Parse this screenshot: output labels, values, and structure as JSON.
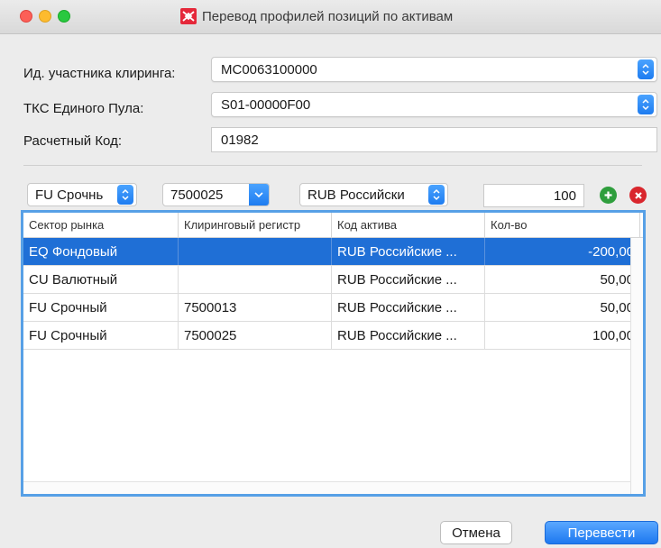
{
  "window": {
    "title": "Перевод профилей позиций по активам",
    "accent": "#1f6fd6"
  },
  "form": {
    "participant_label": "Ид. участника клиринга:",
    "participant_value": "MC0063100000",
    "tks_label": "ТКС Единого Пула:",
    "tks_value": "S01-00000F00",
    "code_label": "Расчетный Код:",
    "code_value": "01982"
  },
  "filters": {
    "sector_value": "FU Срочнь",
    "register_value": "7500025",
    "asset_value": "RUB Российски",
    "quantity_value": "100"
  },
  "table": {
    "columns": [
      "Сектор рынка",
      "Клиринговый регистр",
      "Код актива",
      "Кол-во"
    ],
    "rows": [
      {
        "sector": "EQ Фондовый",
        "register": "",
        "asset": "RUB Российские ...",
        "qty": "-200,00",
        "selected": true
      },
      {
        "sector": "CU Валютный",
        "register": "",
        "asset": "RUB Российские ...",
        "qty": "50,00"
      },
      {
        "sector": "FU Срочный",
        "register": "7500013",
        "asset": "RUB Российские ...",
        "qty": "50,00"
      },
      {
        "sector": "FU Срочный",
        "register": "7500025",
        "asset": "RUB Российские ...",
        "qty": "100,00"
      }
    ]
  },
  "buttons": {
    "cancel": "Отмена",
    "submit": "Перевести"
  },
  "icons": {
    "add": "plus-circle-icon",
    "remove": "x-circle-icon",
    "logo": "moex-logo-icon"
  }
}
